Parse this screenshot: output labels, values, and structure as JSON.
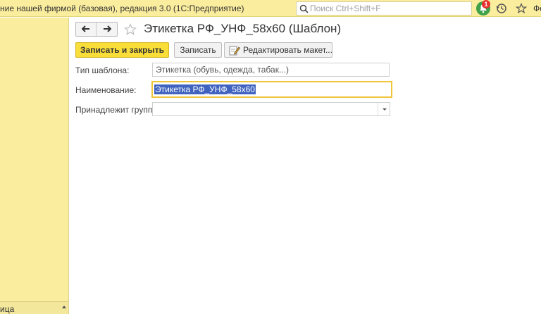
{
  "window": {
    "title": "ние нашей фирмой (базовая), редакция 3.0  (1С:Предприятие)",
    "trailing_text": "Фе"
  },
  "search": {
    "placeholder": "Поиск Ctrl+Shift+F",
    "value": ""
  },
  "notifications": {
    "count": "1",
    "icon": "bell-icon",
    "color": "#3fa14a",
    "badge_color": "#e8302d"
  },
  "sidebar": {
    "bottom_label": "ица"
  },
  "form": {
    "title": "Этикетка РФ_УНФ_58x60 (Шаблон)",
    "buttons": {
      "save_close": "Записать и закрыть",
      "save": "Записать",
      "edit_layout": "Редактировать макет..."
    },
    "fields": {
      "type": {
        "label": "Тип шаблона:",
        "value": "Этикетка (обувь, одежда, табак...)"
      },
      "name": {
        "label": "Наименование:",
        "value": "Этикетка РФ_УНФ_58x60"
      },
      "group": {
        "label": "Принадлежит группе:",
        "value": ""
      }
    }
  },
  "colors": {
    "topbar": "#fbed9e",
    "primary_button": "#f9de3a",
    "focus_border": "#f0c53a",
    "selection": "#3f63bf"
  }
}
